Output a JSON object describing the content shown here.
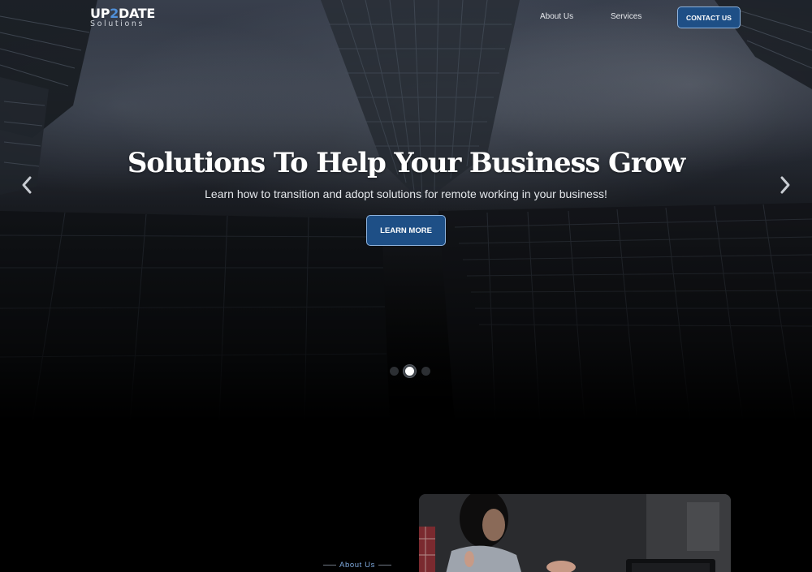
{
  "header": {
    "logo": {
      "main_prefix": "UP",
      "main_accent": "2",
      "main_suffix": "DATE",
      "sub": "Solutions"
    },
    "nav": {
      "about_label": "About Us",
      "services_label": "Services",
      "contact_label": "CONTACT US"
    }
  },
  "hero": {
    "title": "Solutions To Help Your Business Grow",
    "subtitle": "Learn how to transition and adopt solutions for remote working in your business!",
    "cta_label": "LEARN MORE",
    "slides_total": 3,
    "active_slide": 2,
    "icons": {
      "prev": "chevron-left-icon",
      "next": "chevron-right-icon"
    }
  },
  "about": {
    "label": "About Us"
  },
  "colors": {
    "accent": "#1e4f86",
    "accent_border": "#8fb4de",
    "logo_accent": "#4f8fd9",
    "about_label": "#7fa9de",
    "page_background": "#000000"
  }
}
